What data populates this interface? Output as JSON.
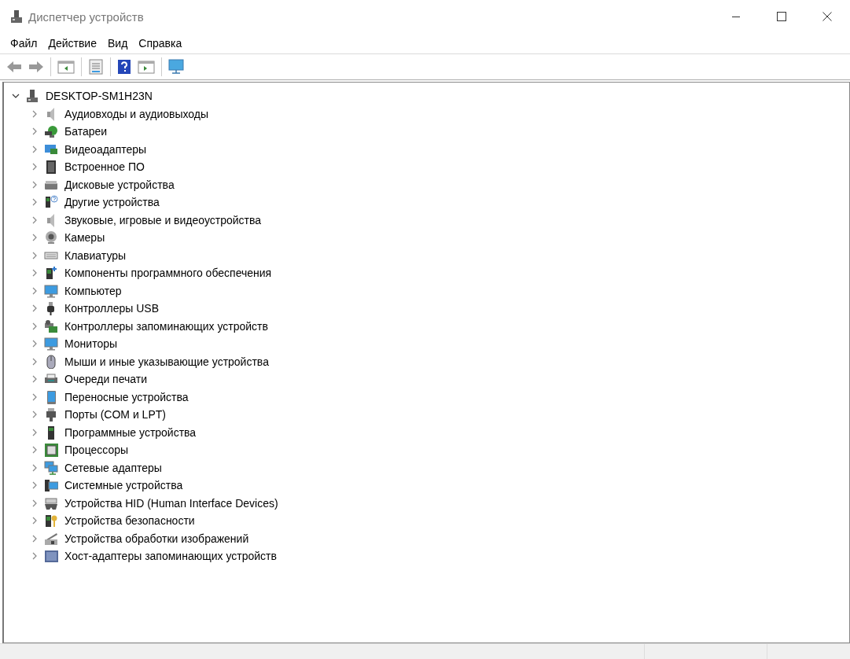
{
  "window": {
    "title": "Диспетчер устройств"
  },
  "menu": [
    "Файл",
    "Действие",
    "Вид",
    "Справка"
  ],
  "tree": {
    "label": "DESKTOP-SM1H23N",
    "kind": "computer-root",
    "expanded": true,
    "children": [
      {
        "label": "Аудиовходы и аудиовыходы",
        "kind": "speaker",
        "expanded": false
      },
      {
        "label": "Батареи",
        "kind": "battery",
        "expanded": false
      },
      {
        "label": "Видеоадаптеры",
        "kind": "display-adapter",
        "expanded": false
      },
      {
        "label": "Встроенное ПО",
        "kind": "chip",
        "expanded": false
      },
      {
        "label": "Дисковые устройства",
        "kind": "drive",
        "expanded": false
      },
      {
        "label": "Другие устройства",
        "kind": "unknown",
        "expanded": false
      },
      {
        "label": "Звуковые, игровые и видеоустройства",
        "kind": "speaker",
        "expanded": false
      },
      {
        "label": "Камеры",
        "kind": "camera",
        "expanded": false
      },
      {
        "label": "Клавиатуры",
        "kind": "keyboard",
        "expanded": false
      },
      {
        "label": "Компоненты программного обеспечения",
        "kind": "component",
        "expanded": false
      },
      {
        "label": "Компьютер",
        "kind": "monitor",
        "expanded": false
      },
      {
        "label": "Контроллеры USB",
        "kind": "usb",
        "expanded": false
      },
      {
        "label": "Контроллеры запоминающих устройств",
        "kind": "storage",
        "expanded": false
      },
      {
        "label": "Мониторы",
        "kind": "monitor",
        "expanded": false
      },
      {
        "label": "Мыши и иные указывающие устройства",
        "kind": "mouse",
        "expanded": false
      },
      {
        "label": "Очереди печати",
        "kind": "printer",
        "expanded": false
      },
      {
        "label": "Переносные устройства",
        "kind": "tablet",
        "expanded": false
      },
      {
        "label": "Порты (COM и LPT)",
        "kind": "port",
        "expanded": false
      },
      {
        "label": "Программные устройства",
        "kind": "tower",
        "expanded": false
      },
      {
        "label": "Процессоры",
        "kind": "processor",
        "expanded": false
      },
      {
        "label": "Сетевые адаптеры",
        "kind": "network",
        "expanded": false
      },
      {
        "label": "Системные устройства",
        "kind": "system",
        "expanded": false
      },
      {
        "label": "Устройства HID (Human Interface Devices)",
        "kind": "hid",
        "expanded": false
      },
      {
        "label": "Устройства безопасности",
        "kind": "security",
        "expanded": false
      },
      {
        "label": "Устройства обработки изображений",
        "kind": "scanner",
        "expanded": false
      },
      {
        "label": "Хост-адаптеры запоминающих устройств",
        "kind": "host-adapter",
        "expanded": false
      }
    ]
  }
}
